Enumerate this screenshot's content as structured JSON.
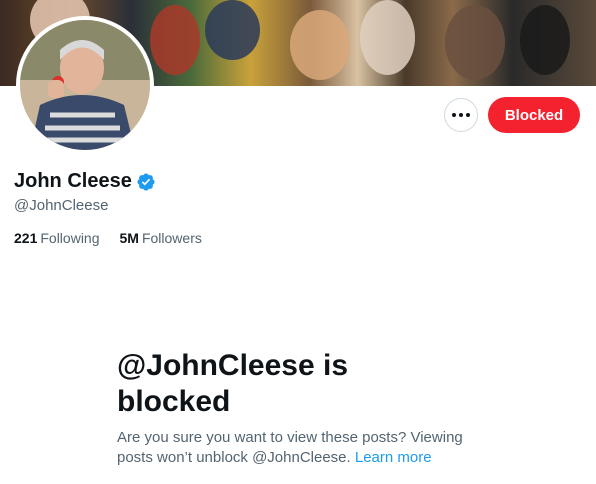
{
  "profile": {
    "name": "John Cleese",
    "handle": "@JohnCleese",
    "following_count": "221",
    "following_label": "Following",
    "followers_count": "5M",
    "followers_label": "Followers"
  },
  "actions": {
    "blocked_label": "Blocked"
  },
  "blocked_notice": {
    "title": "@JohnCleese is blocked",
    "description": "Are you sure you want to view these posts? Viewing posts won’t unblock @JohnCleese.",
    "learn_more": "Learn more"
  },
  "colors": {
    "blocked_button": "#f4212e",
    "verified_badge": "#1d9bf0",
    "link": "#1d9bf0",
    "secondary_text": "#536471"
  },
  "icons": {
    "more": "more-options-icon",
    "verified": "verified-badge-icon"
  }
}
